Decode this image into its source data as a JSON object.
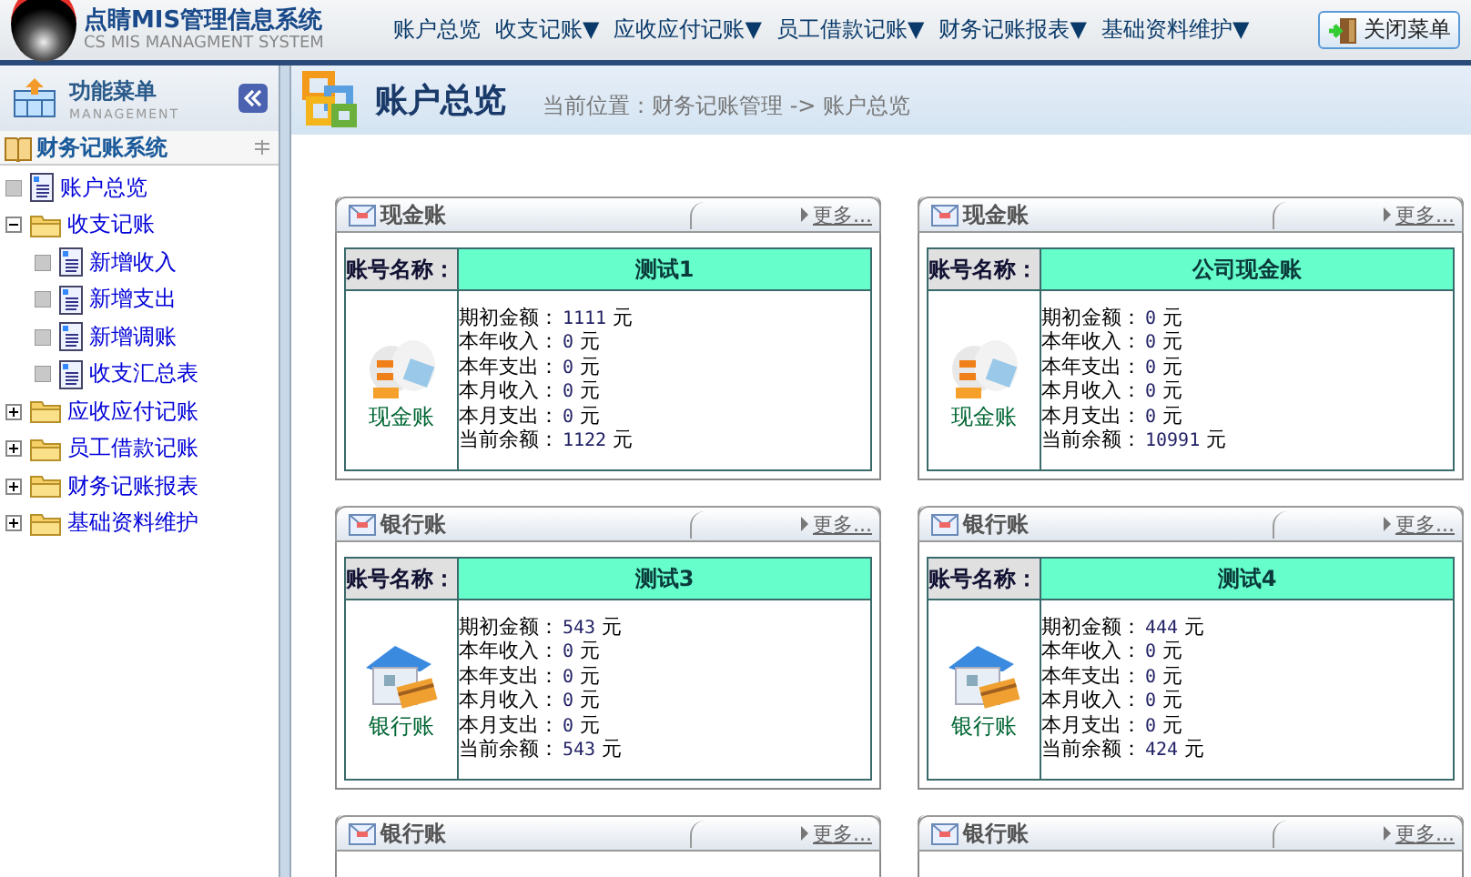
{
  "header": {
    "title": "点睛MIS管理信息系统",
    "subtitle": "CS MIS MANAGMENT SYSTEM",
    "nav": [
      {
        "label": "账户总览"
      },
      {
        "label": "收支记账▼"
      },
      {
        "label": "应收应付记账▼"
      },
      {
        "label": "员工借款记账▼"
      },
      {
        "label": "财务记账报表▼"
      },
      {
        "label": "基础资料维护▼"
      }
    ],
    "close_button": "关闭菜单"
  },
  "sidebar": {
    "title": "功能菜单",
    "subtitle": "MANAGEMENT",
    "tree_title": "财务记账系统",
    "items": [
      {
        "label": "账户总览",
        "kind": "page"
      },
      {
        "label": "收支记账",
        "kind": "folder",
        "expanded": true,
        "children": [
          {
            "label": "新增收入",
            "kind": "page"
          },
          {
            "label": "新增支出",
            "kind": "page"
          },
          {
            "label": "新增调账",
            "kind": "page"
          },
          {
            "label": "收支汇总表",
            "kind": "page"
          }
        ]
      },
      {
        "label": "应收应付记账",
        "kind": "folder",
        "expanded": false
      },
      {
        "label": "员工借款记账",
        "kind": "folder",
        "expanded": false
      },
      {
        "label": "财务记账报表",
        "kind": "folder",
        "expanded": false
      },
      {
        "label": "基础资料维护",
        "kind": "folder",
        "expanded": false
      }
    ]
  },
  "main": {
    "title": "账户总览",
    "breadcrumb": "当前位置：财务记账管理 -> 账户总览",
    "panels": [
      {
        "kind": "cash",
        "title": "现金账",
        "more": "更多...",
        "name_label": "账号名称：",
        "account_name": "测试1",
        "icon_label": "现金账",
        "lines": [
          {
            "label": "期初金额：",
            "value": "1111",
            "unit": "元"
          },
          {
            "label": "本年收入：",
            "value": "0",
            "unit": "元"
          },
          {
            "label": "本年支出：",
            "value": "0",
            "unit": "元"
          },
          {
            "label": "本月收入：",
            "value": "0",
            "unit": "元"
          },
          {
            "label": "本月支出：",
            "value": "0",
            "unit": "元"
          },
          {
            "label": "当前余额：",
            "value": "1122",
            "unit": "元"
          }
        ]
      },
      {
        "kind": "cash",
        "title": "现金账",
        "more": "更多...",
        "name_label": "账号名称：",
        "account_name": "公司现金账",
        "icon_label": "现金账",
        "lines": [
          {
            "label": "期初金额：",
            "value": "0",
            "unit": "元"
          },
          {
            "label": "本年收入：",
            "value": "0",
            "unit": "元"
          },
          {
            "label": "本年支出：",
            "value": "0",
            "unit": "元"
          },
          {
            "label": "本月收入：",
            "value": "0",
            "unit": "元"
          },
          {
            "label": "本月支出：",
            "value": "0",
            "unit": "元"
          },
          {
            "label": "当前余额：",
            "value": "10991",
            "unit": "元"
          }
        ]
      },
      {
        "kind": "bank",
        "title": "银行账",
        "more": "更多...",
        "name_label": "账号名称：",
        "account_name": "测试3",
        "icon_label": "银行账",
        "lines": [
          {
            "label": "期初金额：",
            "value": "543",
            "unit": "元"
          },
          {
            "label": "本年收入：",
            "value": "0",
            "unit": "元"
          },
          {
            "label": "本年支出：",
            "value": "0",
            "unit": "元"
          },
          {
            "label": "本月收入：",
            "value": "0",
            "unit": "元"
          },
          {
            "label": "本月支出：",
            "value": "0",
            "unit": "元"
          },
          {
            "label": "当前余额：",
            "value": "543",
            "unit": "元"
          }
        ]
      },
      {
        "kind": "bank",
        "title": "银行账",
        "more": "更多...",
        "name_label": "账号名称：",
        "account_name": "测试4",
        "icon_label": "银行账",
        "lines": [
          {
            "label": "期初金额：",
            "value": "444",
            "unit": "元"
          },
          {
            "label": "本年收入：",
            "value": "0",
            "unit": "元"
          },
          {
            "label": "本年支出：",
            "value": "0",
            "unit": "元"
          },
          {
            "label": "本月收入：",
            "value": "0",
            "unit": "元"
          },
          {
            "label": "本月支出：",
            "value": "0",
            "unit": "元"
          },
          {
            "label": "当前余额：",
            "value": "424",
            "unit": "元"
          }
        ]
      },
      {
        "title": "银行账",
        "more": "更多..."
      },
      {
        "title": "银行账",
        "more": "更多..."
      }
    ]
  }
}
